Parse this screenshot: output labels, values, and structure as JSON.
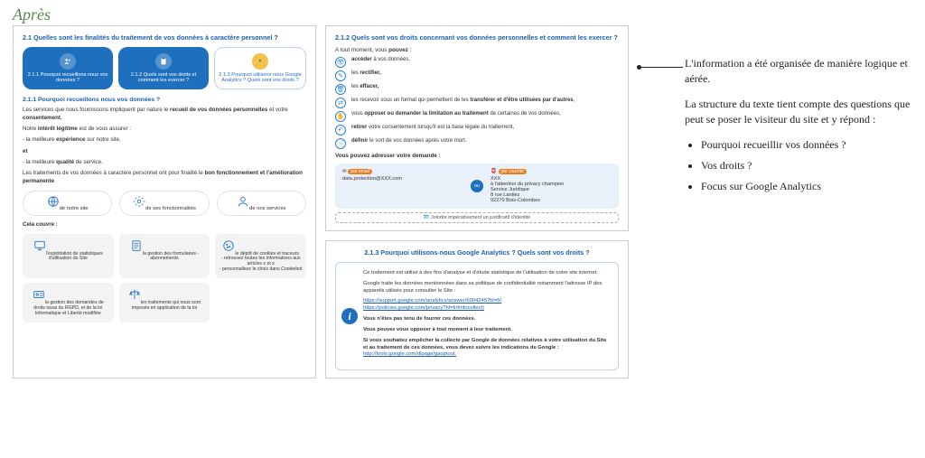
{
  "heading": "Après",
  "panelA": {
    "title": "2.1 Quelles sont les finalités du traitement de vos données à caractère personnel ?",
    "pills": [
      "2.1.1 Pourquoi recueillons nous vos données ?",
      "2.1.2 Quels sont vos droits et comment les exercer ?",
      "2.1.3 Pourquoi utilisons nous Google Analytics ? Quels sont vos droits ?"
    ],
    "sub": "2.1.1 Pourquoi recueillons nous vos données ?",
    "p1a": "Les services que nous fournissons impliquent par nature le ",
    "p1b": "recueil de vos données personnelles",
    "p1c": " et votre ",
    "p1d": "consentement.",
    "p2a": "Notre ",
    "p2b": "intérêt légitime",
    "p2c": " est de vous assurer :",
    "b1a": "- la meilleure ",
    "b1b": "expérience",
    "b1c": " sur notre site,",
    "b1et": "et",
    "b2a": "- la meilleure ",
    "b2b": "qualité",
    "b2c": " de service.",
    "p3a": "Les traitements de vos données à caractère personnel ont pour finalité le ",
    "p3b": "bon fonctionnement et l'amélioration permanente",
    "svc": [
      "de notre site",
      "de ses fonctionnalités",
      "de nos services"
    ],
    "cela": "Cela couvre :",
    "tilesRow1": [
      "l'exploitation de statistiques d'utilisation du Site",
      "la gestion des formulaires - abonnements",
      "le dépôt de cookies et traceurs\n- retrouvez toutes les informations aux articles x et x\n- personnalisez le choix dans Cookiebot"
    ],
    "tilesRow2": [
      "la gestion des demandes de droits issus du RGPD, et de la loi Informatique et Liberté modifiée",
      "les traitements qui nous sont imposés en application de la loi"
    ]
  },
  "panelC": {
    "title": "2.1.2 Quels sont vos droits concernant vos données personnelles et comment les exercer ?",
    "introA": "A tout moment, vous ",
    "introB": "pouvez",
    "introC": " :",
    "rights": [
      {
        "b": "accéder",
        "t": " à vos données,"
      },
      {
        "pre": "les ",
        "b": "rectifier,",
        "t": ""
      },
      {
        "pre": "les ",
        "b": "effacer,",
        "t": ""
      },
      {
        "pre": "les recevoir sous un format qui permettent de les ",
        "b": "transférer et d'être utilisées par d'autres",
        "t": ","
      },
      {
        "pre": "vous ",
        "b": "opposer ou demander la limitation au traitement",
        "t": " de certaines de vos données,"
      },
      {
        "pre": "",
        "b": "retirer",
        "t": " votre consentement lorsqu'il est la base légale du traitement,"
      },
      {
        "pre": "",
        "b": "définir",
        "t": " le sort de vos données après votre mort."
      }
    ],
    "addr": "Vous pouvez adresser votre demande :",
    "tagEmail": "par email",
    "email": "data.protection@XXX.com",
    "ou": "ou",
    "tagMail": "par courrier",
    "postal": "XXX\nà l'attention du privacy champion\nService Juridique\n8 rue Lantiez\n92270 Bois-Colombes",
    "joint": "Joindre impérativement un justificatif d'identité"
  },
  "panelD": {
    "title": "2.1.3 Pourquoi utilisons-nous Google Analytics ? Quels sont vos droits ?",
    "p1": "Ce traitement est utilisé à des fins d'analyse et d'étude statistique de l'utilisation de notre site internet.",
    "p2": "Google traite les données mentionnées dans sa politique de confidentialité notamment l'adresse IP des appareils utilisés pour consulter le Site :",
    "link1": "https://support.google.com/analytics/answer/6004245?hl=fr/",
    "link2": "https://policies.google.com/privacy?hl=fr#infocollect)",
    "p3": "Vous n'êtes pas tenu de fournir ces données.",
    "p4": "Vous pouvez vous opposer à tout moment à leur traitement.",
    "p5a": "Si vous souhaitez empêcher la collecte par Google de données relatives à votre utilisation du Site et au traitement de ces données, vous devez suivre les indications de Google : ",
    "p5link": "http://tools.google.com/dlpage/gaoptout."
  },
  "annot": {
    "p1": "L'information a été organisée de manière logique et aérée.",
    "p2": "La structure du texte tient compte des questions que peut se poser le visiteur du site et y répond :",
    "b1": "Pourquoi recueillir vos données ?",
    "b2": "Vos droits ?",
    "b3": "Focus sur Google Analytics"
  }
}
